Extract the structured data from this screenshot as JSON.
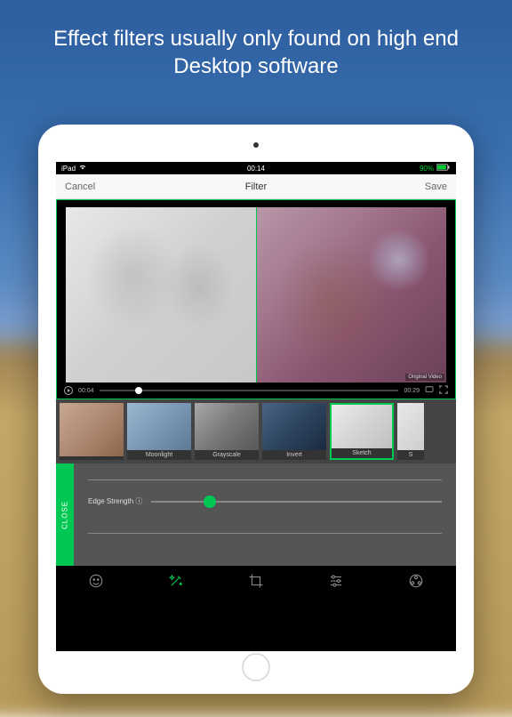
{
  "headline": "Effect filters usually only found on high end Desktop software",
  "statusbar": {
    "carrier": "iPad",
    "wifi": "wifi",
    "time": "00:14",
    "battery": "90%"
  },
  "topbar": {
    "cancel": "Cancel",
    "title": "Filter",
    "save": "Save"
  },
  "preview": {
    "original_label": "Original Video"
  },
  "playbar": {
    "current": "00:04",
    "total": "00:29"
  },
  "filters": [
    {
      "label": ""
    },
    {
      "label": "Moonlight"
    },
    {
      "label": "Grayscale"
    },
    {
      "label": "Invert"
    },
    {
      "label": "Sketch",
      "selected": true
    },
    {
      "label": "S"
    }
  ],
  "adjust": {
    "close": "CLOSE",
    "slider_label": "Edge Strength ⓘ"
  },
  "tools": [
    "face",
    "magic",
    "crop",
    "sliders",
    "radiation"
  ]
}
